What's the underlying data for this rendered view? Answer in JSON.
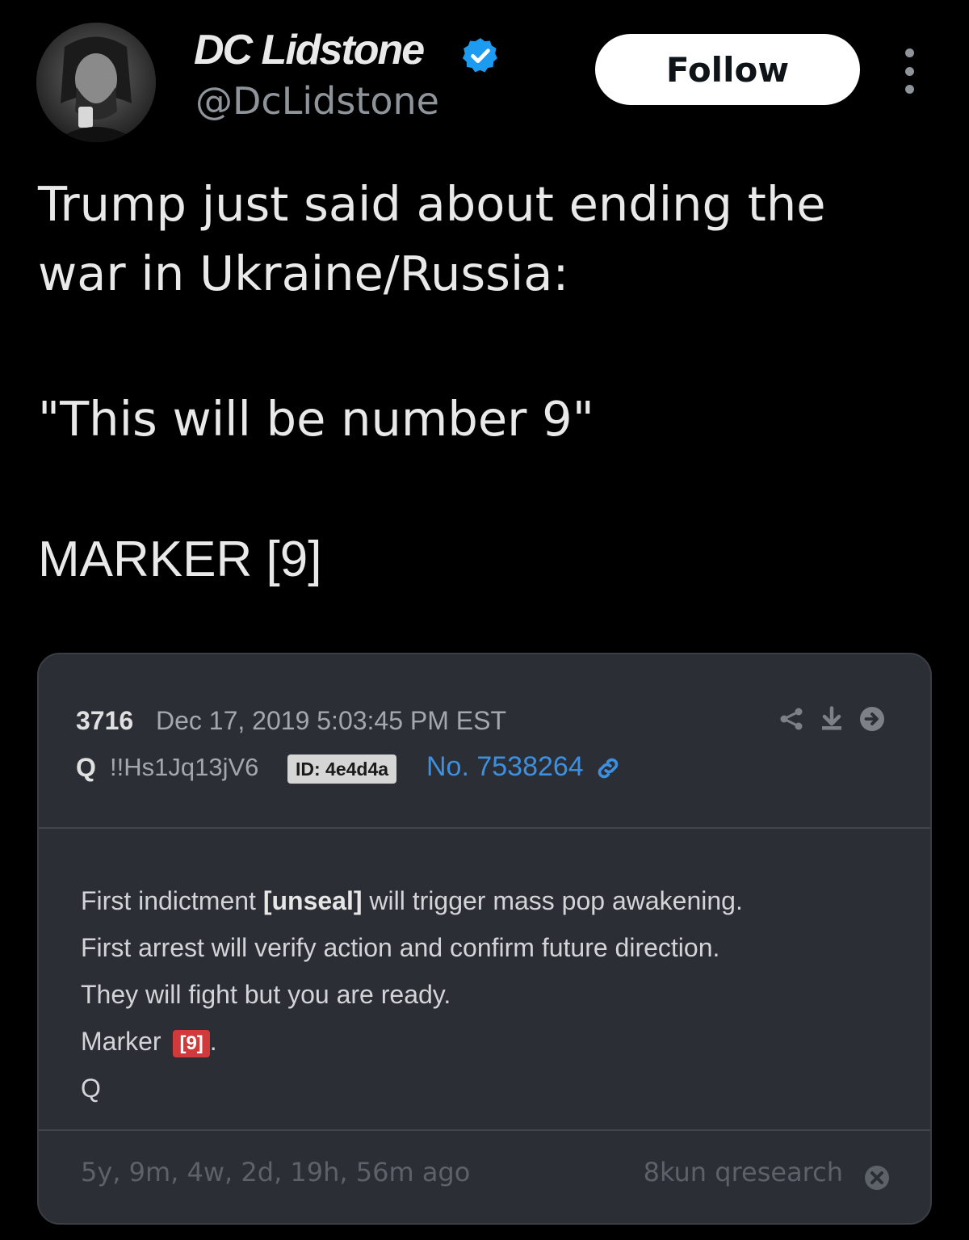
{
  "tweet": {
    "author": {
      "display_name": "DC Lidstone",
      "handle": "@DcLidstone",
      "verified_icon": "verified-badge-icon"
    },
    "follow_label": "Follow",
    "more_icon": "more-vertical-icon",
    "text_lines": [
      "Trump just said about ending the",
      "war in Ukraine/Russia:",
      "\"This will be number 9\"",
      "MARKER [9]"
    ]
  },
  "embedded_post": {
    "post_number": "3716",
    "date": "Dec 17, 2019 5:03:45 PM EST",
    "author": "Q",
    "tripcode": "!!Hs1Jq13jV6",
    "id_badge": "ID: 4e4d4a",
    "post_no": "No. 7538264",
    "body": {
      "line1_pre": "First indictment ",
      "line1_bold": "[unseal]",
      "line1_post": " will trigger mass pop awakening.",
      "line2": "First arrest will verify action and confirm future direction.",
      "line3": "They will fight but you are ready.",
      "line4_pre": "Marker ",
      "line4_badge": "[9]",
      "line4_post": ".",
      "line5": "Q"
    },
    "footer": {
      "time_ago": "5y, 9m, 4w, 2d, 19h, 56m ago",
      "source": "8kun qresearch"
    }
  },
  "colors": {
    "background": "#000000",
    "card_background": "#2b2e35",
    "link_blue": "#3d8fe0",
    "verified_blue": "#1d9bf0",
    "marker_red": "#d03a3a"
  }
}
